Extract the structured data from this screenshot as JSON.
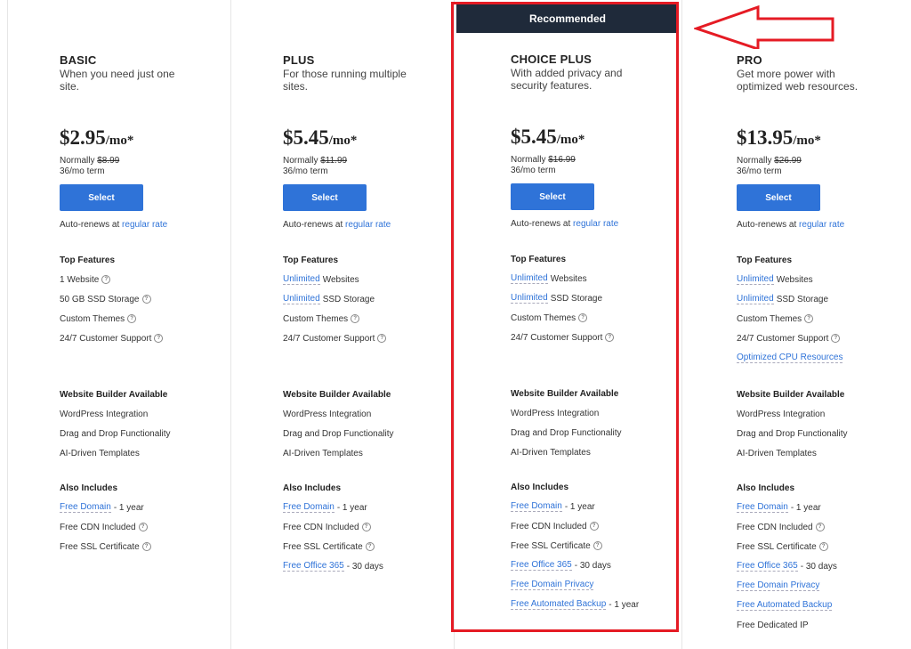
{
  "banner": "Recommended",
  "colors": {
    "accent": "#2f73d8",
    "highlight": "#e51b24",
    "banner_bg": "#1f2a3a"
  },
  "common": {
    "select_label": "Select",
    "auto_renews": "Auto-renews at ",
    "regular_rate": "regular rate",
    "top_features": "Top Features",
    "website_builder": "Website Builder Available",
    "also_includes": "Also Includes",
    "normally": "Normally ",
    "builder_items": [
      "WordPress Integration",
      "Drag and Drop Functionality",
      "AI-Driven Templates"
    ]
  },
  "plans": [
    {
      "name": "BASIC",
      "desc": "When you need just one site.",
      "price": "$2.95",
      "unit": "/mo*",
      "normal_price": "$8.99",
      "term": "36/mo term",
      "top_features": [
        {
          "link": "",
          "text": "1 Website",
          "help": true
        },
        {
          "link": "",
          "text": "50 GB SSD Storage",
          "help": true
        },
        {
          "link": "",
          "text": "Custom Themes",
          "help": true
        },
        {
          "link": "",
          "text": "24/7 Customer Support",
          "help": true
        }
      ],
      "includes": [
        {
          "link": "Free Domain",
          "text": " - 1 year",
          "help": false
        },
        {
          "link": "",
          "text": "Free CDN Included",
          "help": true
        },
        {
          "link": "",
          "text": "Free SSL Certificate",
          "help": true
        }
      ]
    },
    {
      "name": "PLUS",
      "desc": "For those running multiple sites.",
      "price": "$5.45",
      "unit": "/mo*",
      "normal_price": "$11.99",
      "term": "36/mo term",
      "top_features": [
        {
          "link": "Unlimited",
          "text": " Websites",
          "help": false
        },
        {
          "link": "Unlimited",
          "text": " SSD Storage",
          "help": false
        },
        {
          "link": "",
          "text": "Custom Themes",
          "help": true
        },
        {
          "link": "",
          "text": "24/7 Customer Support",
          "help": true
        }
      ],
      "includes": [
        {
          "link": "Free Domain",
          "text": " - 1 year",
          "help": false
        },
        {
          "link": "",
          "text": "Free CDN Included",
          "help": true
        },
        {
          "link": "",
          "text": "Free SSL Certificate",
          "help": true
        },
        {
          "link": "Free Office 365",
          "text": " - 30 days",
          "help": false
        }
      ]
    },
    {
      "name": "CHOICE PLUS",
      "desc": "With added privacy and security features.",
      "price": "$5.45",
      "unit": "/mo*",
      "normal_price": "$16.99",
      "term": "36/mo term",
      "top_features": [
        {
          "link": "Unlimited",
          "text": " Websites",
          "help": false
        },
        {
          "link": "Unlimited",
          "text": " SSD Storage",
          "help": false
        },
        {
          "link": "",
          "text": "Custom Themes",
          "help": true
        },
        {
          "link": "",
          "text": "24/7 Customer Support",
          "help": true
        }
      ],
      "includes": [
        {
          "link": "Free Domain",
          "text": " - 1 year",
          "help": false
        },
        {
          "link": "",
          "text": "Free CDN Included",
          "help": true
        },
        {
          "link": "",
          "text": "Free SSL Certificate",
          "help": true
        },
        {
          "link": "Free Office 365",
          "text": " - 30 days",
          "help": false
        },
        {
          "link": "Free Domain Privacy",
          "text": "",
          "help": false
        },
        {
          "link": "Free Automated Backup",
          "text": " - 1 year",
          "help": false
        }
      ]
    },
    {
      "name": "PRO",
      "desc": "Get more power with optimized web resources.",
      "price": "$13.95",
      "unit": "/mo*",
      "normal_price": "$26.99",
      "term": "36/mo term",
      "top_features": [
        {
          "link": "Unlimited",
          "text": " Websites",
          "help": false
        },
        {
          "link": "Unlimited",
          "text": " SSD Storage",
          "help": false
        },
        {
          "link": "",
          "text": "Custom Themes",
          "help": true
        },
        {
          "link": "",
          "text": "24/7 Customer Support",
          "help": true
        },
        {
          "link": "Optimized CPU Resources",
          "text": "",
          "help": false
        }
      ],
      "includes": [
        {
          "link": "Free Domain",
          "text": " - 1 year",
          "help": false
        },
        {
          "link": "",
          "text": "Free CDN Included",
          "help": true
        },
        {
          "link": "",
          "text": "Free SSL Certificate",
          "help": true
        },
        {
          "link": "Free Office 365",
          "text": " - 30 days",
          "help": false
        },
        {
          "link": "Free Domain Privacy",
          "text": "",
          "help": false
        },
        {
          "link": "Free Automated Backup",
          "text": "",
          "help": false
        },
        {
          "link": "",
          "text": "Free Dedicated IP",
          "help": false
        }
      ]
    }
  ]
}
